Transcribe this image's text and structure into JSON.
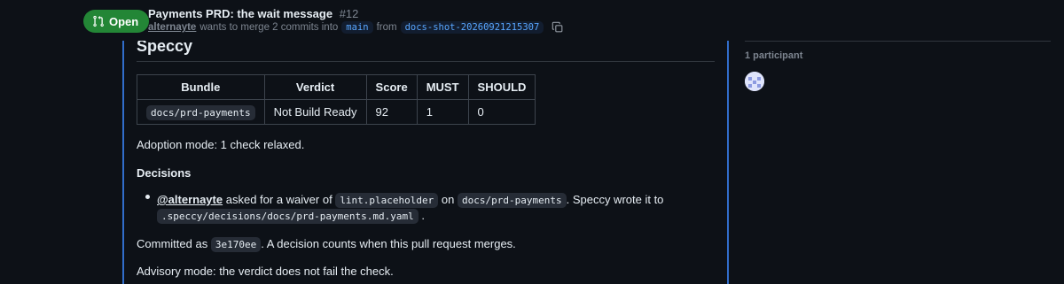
{
  "header": {
    "state": "Open",
    "title": "Payments PRD: the wait message",
    "number": "#12",
    "author": "alternayte",
    "merge_text": "wants to merge 2 commits into",
    "base_branch": "main",
    "from_text": "from",
    "head_branch": "docs-shot-20260921215307"
  },
  "comment": {
    "heading": "Speccy",
    "table": {
      "headers": [
        "Bundle",
        "Verdict",
        "Score",
        "MUST",
        "SHOULD"
      ],
      "row": {
        "bundle": "docs/prd-payments",
        "verdict": "Not Build Ready",
        "score": "92",
        "must": "1",
        "should": "0"
      }
    },
    "adoption": "Adoption mode: 1 check relaxed.",
    "decisions_heading": "Decisions",
    "decision": {
      "mention": "@alternayte",
      "text1": "asked for a waiver of",
      "rule": "lint.placeholder",
      "text2": "on",
      "bundle": "docs/prd-payments",
      "text3": ". Speccy wrote it to",
      "path": ".speccy/decisions/docs/prd-payments.md.yaml",
      "text4": "."
    },
    "committed_prefix": "Committed as",
    "commit_sha": "3e170ee",
    "committed_suffix": ". A decision counts when this pull request merges.",
    "advisory": "Advisory mode: the verdict does not fail the check."
  },
  "sidebar": {
    "participants_label": "1 participant"
  },
  "colors": {
    "open_badge": "#238636",
    "accent_border": "#316dca",
    "branch_text": "#58a6ff"
  }
}
